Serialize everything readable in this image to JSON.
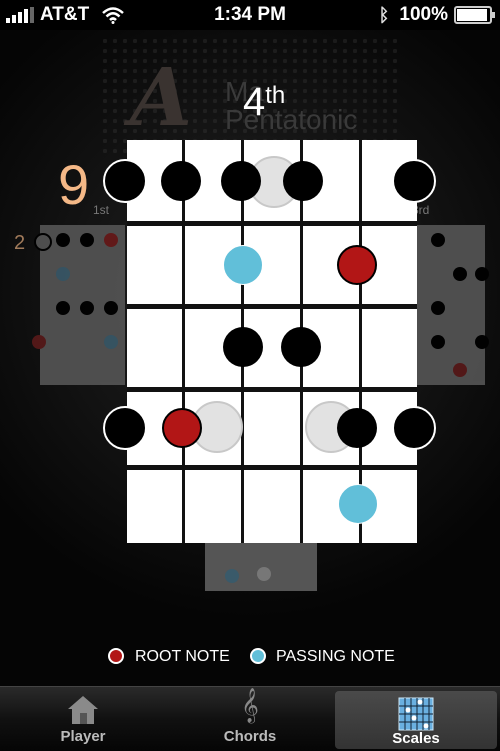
{
  "status_bar": {
    "carrier": "AT&T",
    "time": "1:34 PM",
    "battery": "100%",
    "battery_level": 1.0
  },
  "header": {
    "logo_letter": "A",
    "logo_line1": "Ma",
    "logo_line2": "Pentatonic",
    "position_number": "4",
    "position_suffix": "th"
  },
  "fretboard": {
    "fret_number": "9",
    "left_fret_number": "2",
    "label_first": "1st",
    "label_third": "3rd"
  },
  "legend": {
    "root_label": "ROOT NOTE",
    "passing_label": "PASSING NOTE",
    "root_color": "#b21616",
    "passing_color": "#61bfd9"
  },
  "tabs": [
    {
      "label": "Player",
      "icon": "house-icon"
    },
    {
      "label": "Chords",
      "icon": "treble-clef-icon"
    },
    {
      "label": "Scales",
      "icon": "fretboard-grid-icon",
      "selected": true
    }
  ]
}
